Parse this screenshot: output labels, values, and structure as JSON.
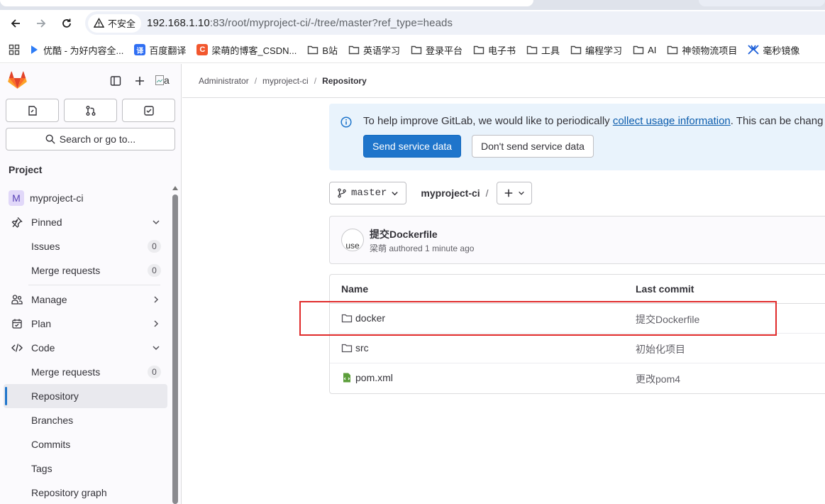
{
  "browser": {
    "security_label": "不安全",
    "url_host": "192.168.1.10",
    "url_path": ":83/root/myproject-ci/-/tree/master?ref_type=heads",
    "bookmarks": [
      {
        "label": "优酷 - 为好内容全...",
        "icon": "youku-icon",
        "color": "#2d7cf6"
      },
      {
        "label": "百度翻译",
        "icon": "translate-icon",
        "color": "#2f6ef3"
      },
      {
        "label": "梁萌的博客_CSDN...",
        "icon": "csdn-icon",
        "color": "#f2572e"
      },
      {
        "label": "B站",
        "icon": "folder-icon"
      },
      {
        "label": "英语学习",
        "icon": "folder-icon"
      },
      {
        "label": "登录平台",
        "icon": "folder-icon"
      },
      {
        "label": "电子书",
        "icon": "folder-icon"
      },
      {
        "label": "工具",
        "icon": "folder-icon"
      },
      {
        "label": "编程学习",
        "icon": "folder-icon"
      },
      {
        "label": "AI",
        "icon": "folder-icon"
      },
      {
        "label": "神领物流项目",
        "icon": "folder-icon"
      },
      {
        "label": "毫秒镜像",
        "icon": "mirror-icon",
        "color": "#1e60d8"
      }
    ]
  },
  "sidebar": {
    "avatar_alt": "a",
    "search_label": "Search or go to...",
    "section_title": "Project",
    "project_initial": "M",
    "project_name": "myproject-ci",
    "pinned": "Pinned",
    "issues": "Issues",
    "issues_count": "0",
    "merge_requests": "Merge requests",
    "merge_requests_count": "0",
    "manage": "Manage",
    "plan": "Plan",
    "code": "Code",
    "code_merge_requests": "Merge requests",
    "code_merge_requests_count": "0",
    "repository": "Repository",
    "branches": "Branches",
    "commits": "Commits",
    "tags": "Tags",
    "repository_graph": "Repository graph"
  },
  "breadcrumb": {
    "items": [
      "Administrator",
      "myproject-ci",
      "Repository"
    ]
  },
  "alert": {
    "text_before": "To help improve GitLab, we would like to periodically ",
    "link": "collect usage information",
    "text_after": ". This can be chang",
    "primary_button": "Send service data",
    "secondary_button": "Don't send service data"
  },
  "repo": {
    "branch": "master",
    "project_path": "myproject-ci",
    "path_separator": "/"
  },
  "commit": {
    "avatar_alt": "use",
    "title": "提交Dockerfile",
    "author": "梁萌",
    "meta_rest": " authored 1 minute ago"
  },
  "files": {
    "col_name": "Name",
    "col_last_commit": "Last commit",
    "rows": [
      {
        "name": "docker",
        "type": "folder",
        "last_commit": "提交Dockerfile"
      },
      {
        "name": "src",
        "type": "folder",
        "last_commit": "初始化项目"
      },
      {
        "name": "pom.xml",
        "type": "file",
        "last_commit": "更改pom4"
      }
    ]
  },
  "colors": {
    "gitlab_orange": "#fc6d26",
    "primary_blue": "#1f75cb",
    "annotation_red": "#e02b2b"
  }
}
